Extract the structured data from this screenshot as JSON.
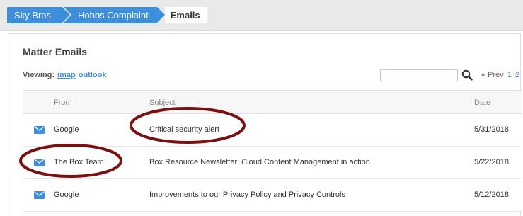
{
  "breadcrumb": [
    "Sky Bros",
    "Hobbs Complaint",
    "Emails"
  ],
  "panel": {
    "title": "Matter Emails",
    "viewing_label": "Viewing:",
    "sources": [
      "imap",
      "outlook"
    ],
    "search_placeholder": "",
    "pager": {
      "prev": "« Prev",
      "pages": [
        "1",
        "2"
      ]
    }
  },
  "table": {
    "columns": [
      "From",
      "Subject",
      "Date"
    ],
    "rows": [
      {
        "from": "Google",
        "subject": "Critical security alert",
        "date": "5/31/2018"
      },
      {
        "from": "The Box Team",
        "subject": "Box Resource Newsletter: Cloud Content Management in action",
        "date": "5/22/2018"
      },
      {
        "from": "Google",
        "subject": "Improvements to our Privacy Policy and Privacy Controls",
        "date": "5/12/2018"
      }
    ]
  },
  "colors": {
    "accent": "#3d8edb",
    "annotation": "#7a1010"
  }
}
